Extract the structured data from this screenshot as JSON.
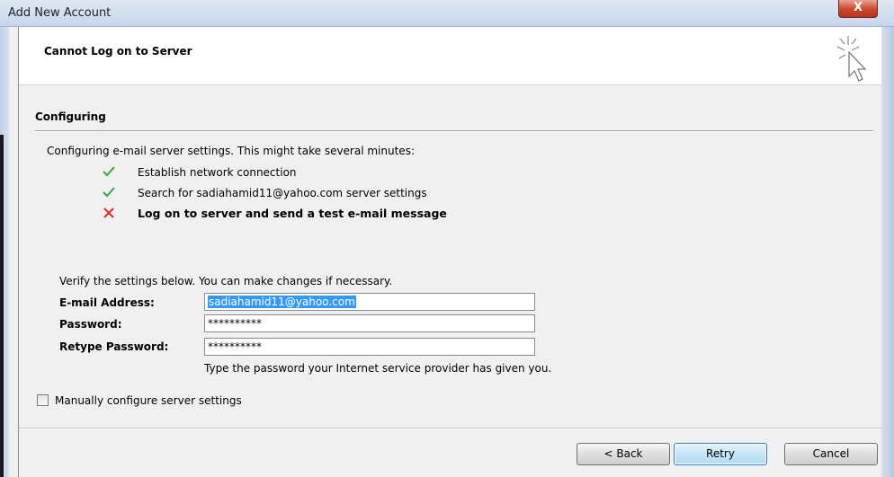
{
  "window": {
    "title": "Add New Account",
    "close_glyph": "X"
  },
  "header": {
    "title": "Cannot Log on to Server",
    "icon": "cursor-sparkle-icon"
  },
  "section": {
    "title": "Configuring"
  },
  "status": {
    "intro": "Configuring e-mail server settings. This might take several minutes:",
    "steps": [
      {
        "label": "Establish network connection",
        "state": "success",
        "icon": "check-icon"
      },
      {
        "label": "Search for sadiahamid11@yahoo.com server settings",
        "state": "success",
        "icon": "check-icon"
      },
      {
        "label": "Log on to server and send a test e-mail message",
        "state": "failed",
        "icon": "x-icon"
      }
    ]
  },
  "form": {
    "intro": "Verify the settings below. You can make changes if necessary.",
    "email": {
      "label": "E-mail Address:",
      "value": "sadiahamid11@yahoo.com"
    },
    "password": {
      "label": "Password:",
      "value": "**********"
    },
    "retype": {
      "label": "Retype Password:",
      "value": "**********"
    },
    "hint": "Type the password your Internet service provider has given you."
  },
  "manual": {
    "label": "Manually configure server settings",
    "checked": false
  },
  "buttons": {
    "back": "< Back",
    "retry": "Retry",
    "cancel": "Cancel"
  },
  "colors": {
    "check": "#3aa63a",
    "cross": "#e03030",
    "selection": "#3399ff",
    "focus_border": "#3c7fb1"
  }
}
